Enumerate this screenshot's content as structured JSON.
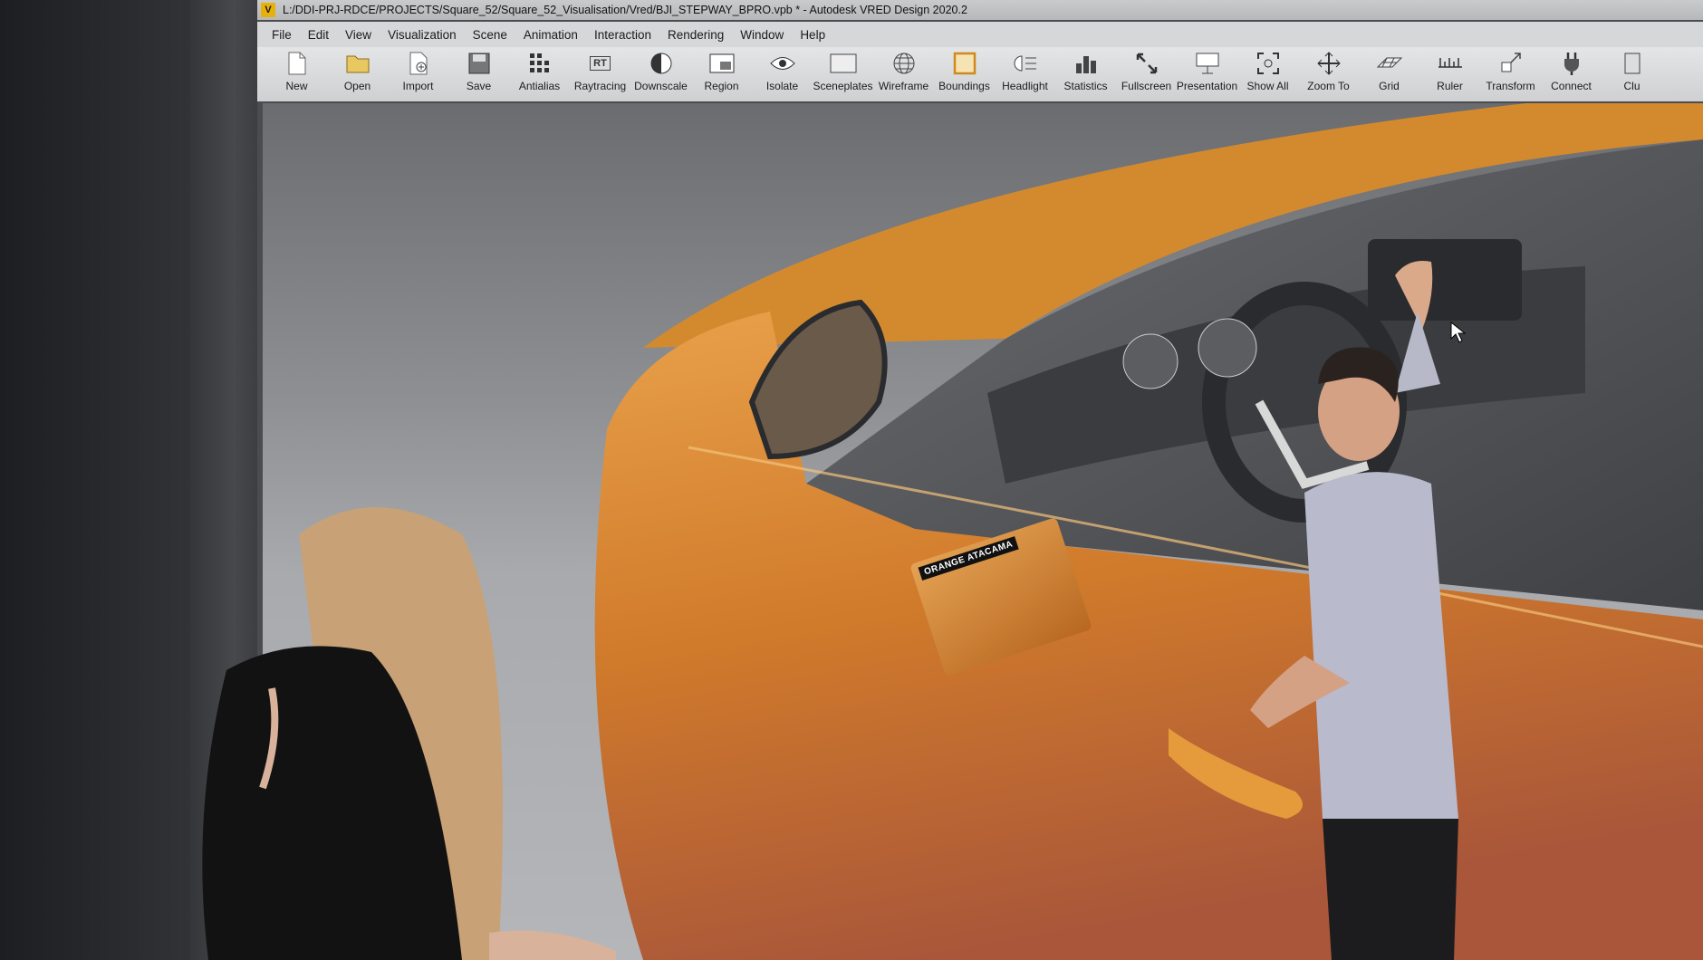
{
  "window": {
    "title": "L:/DDI-PRJ-RDCE/PROJECTS/Square_52/Square_52_Visualisation/Vred/BJI_STEPWAY_BPRO.vpb * - Autodesk VRED Design 2020.2",
    "app_icon": "V"
  },
  "menu": [
    "File",
    "Edit",
    "View",
    "Visualization",
    "Scene",
    "Animation",
    "Interaction",
    "Rendering",
    "Window",
    "Help"
  ],
  "toolbar": [
    {
      "label": "New",
      "icon": "new-document-icon"
    },
    {
      "label": "Open",
      "icon": "folder-open-icon"
    },
    {
      "label": "Import",
      "icon": "import-icon"
    },
    {
      "label": "Save",
      "icon": "save-icon"
    },
    {
      "label": "Antialias",
      "icon": "antialias-icon"
    },
    {
      "label": "Raytracing",
      "icon": "raytracing-icon",
      "glyph": "RT"
    },
    {
      "label": "Downscale",
      "icon": "downscale-icon"
    },
    {
      "label": "Region",
      "icon": "region-icon"
    },
    {
      "label": "Isolate",
      "icon": "isolate-eye-icon"
    },
    {
      "label": "Sceneplates",
      "icon": "sceneplates-icon"
    },
    {
      "label": "Wireframe",
      "icon": "wireframe-globe-icon"
    },
    {
      "label": "Boundings",
      "icon": "boundings-box-icon"
    },
    {
      "label": "Headlight",
      "icon": "headlight-icon"
    },
    {
      "label": "Statistics",
      "icon": "statistics-icon"
    },
    {
      "label": "Fullscreen",
      "icon": "fullscreen-icon"
    },
    {
      "label": "Presentation",
      "icon": "presentation-icon"
    },
    {
      "label": "Show All",
      "icon": "show-all-icon"
    },
    {
      "label": "Zoom To",
      "icon": "zoom-to-icon"
    },
    {
      "label": "Grid",
      "icon": "grid-icon"
    },
    {
      "label": "Ruler",
      "icon": "ruler-icon"
    },
    {
      "label": "Transform",
      "icon": "transform-icon"
    },
    {
      "label": "Connect",
      "icon": "connect-plug-icon"
    },
    {
      "label": "Clu",
      "icon": "cluster-icon"
    }
  ],
  "scene": {
    "sample_card_text": "ORANGE ATACAMA",
    "car_color": "#d9892c"
  }
}
